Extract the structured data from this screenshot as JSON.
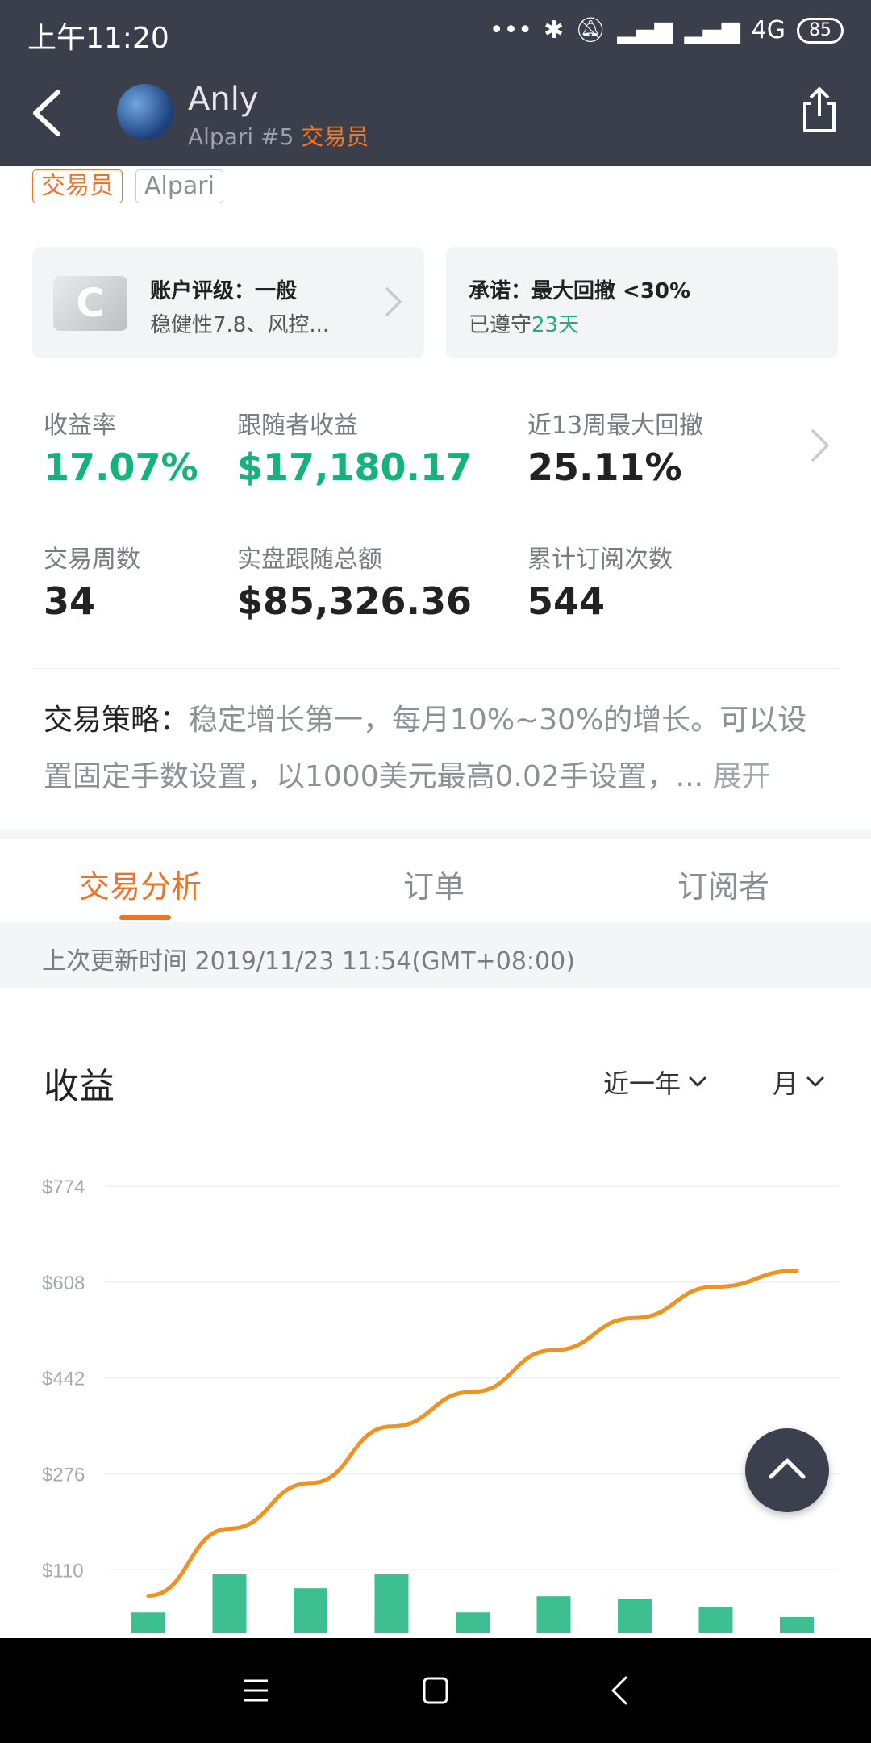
{
  "status": {
    "time": "上午11:20",
    "network": "4G",
    "battery": "85"
  },
  "header": {
    "name": "Anly",
    "broker": "Alpari #5",
    "role": "交易员"
  },
  "tags": [
    "交易员",
    "Alpari"
  ],
  "cards": {
    "rating": {
      "badge": "C",
      "title": "账户评级：一般",
      "subtitle": "稳健性7.8、风控..."
    },
    "promise": {
      "title": "承诺：最大回撤 <30%",
      "sub_prefix": "已遵守",
      "days": "23天"
    }
  },
  "stats": [
    {
      "label": "收益率",
      "value": "17.07%"
    },
    {
      "label": "跟随者收益",
      "value": "$17,180.17"
    },
    {
      "label": "近13周最大回撤",
      "value": "25.11%"
    },
    {
      "label": "交易周数",
      "value": "34"
    },
    {
      "label": "实盘跟随总额",
      "value": "$85,326.36"
    },
    {
      "label": "累计订阅次数",
      "value": "544"
    }
  ],
  "strategy": {
    "label": "交易策略：",
    "text": "稳定增长第一，每月10%~30%的增长。可以设置固定手数设置，以1000美元最高0.02手设置，...",
    "more": "展开"
  },
  "tabs": [
    "交易分析",
    "订单",
    "订阅者"
  ],
  "update_text": "上次更新时间 2019/11/23 11:54(GMT+08:00)",
  "chart_section": {
    "title": "收益",
    "period": "近一年",
    "granularity": "月"
  },
  "colors": {
    "accent": "#ef7229",
    "green": "#16b37d",
    "line": "#f0921f",
    "bar": "#3dbf91",
    "header": "#3b3e4b"
  },
  "chart_data": {
    "type": "bar+line",
    "y_ticks": [
      "$774",
      "$608",
      "$442",
      "$276",
      "$110"
    ],
    "ylim": [
      0,
      774
    ],
    "series": [
      {
        "values": [
          65,
          181,
          260,
          358,
          418,
          490,
          546,
          600,
          628
        ]
      },
      {
        "values": [
          36,
          102,
          78,
          102,
          36,
          64,
          60,
          46,
          28
        ]
      }
    ]
  }
}
